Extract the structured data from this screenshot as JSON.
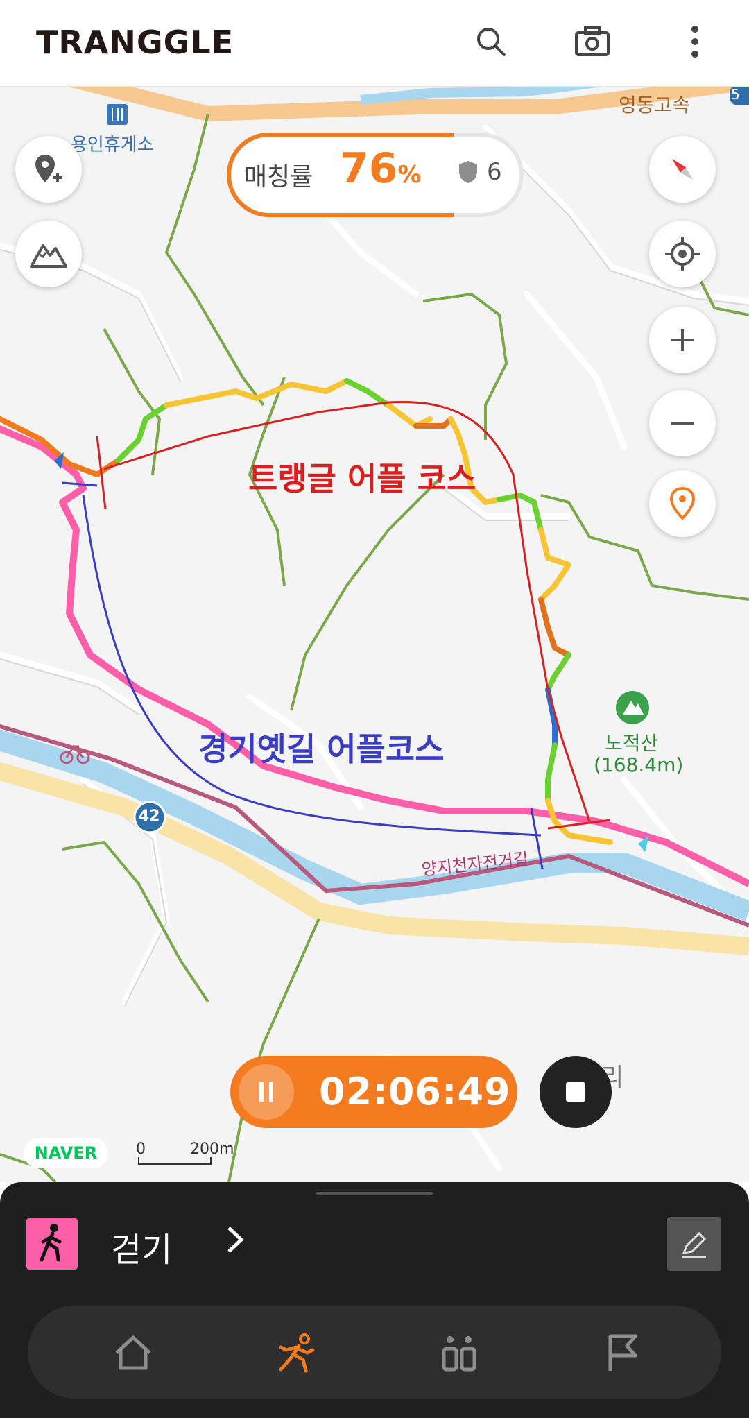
{
  "header": {
    "logo": "TRANGGLE"
  },
  "icons": {
    "search": "search-icon",
    "camera": "camera-icon",
    "more": "more-vert-icon",
    "add_place": "add-location-icon",
    "mountain": "mountain-icon",
    "compass": "compass-icon",
    "my_location": "gps-target-icon",
    "zoom_in": "plus-icon",
    "zoom_out": "minus-icon",
    "pin": "map-pin-icon"
  },
  "match": {
    "label": "매칭률",
    "value": "76",
    "unit": "%",
    "count": "6",
    "progress": 0.76
  },
  "map": {
    "labels": {
      "rest_area": "용인휴게소",
      "highway": "영동고속",
      "mountain_name": "노적산",
      "mountain_height": "(168.4m)",
      "bike_road": "양지천자전거길",
      "village": "송문리",
      "route_42": "42",
      "route_5": "5"
    },
    "annotations": {
      "trangle_course": "트랭글 어플 코스",
      "gyeonggi_course": "경기옛길 어플코스"
    },
    "attribution": "NAVER",
    "scale": {
      "zero": "0",
      "distance": "200m"
    }
  },
  "timer": {
    "elapsed": "02:06:49"
  },
  "activity": {
    "label": "걷기"
  },
  "nav": {
    "items": [
      "home",
      "activity",
      "community",
      "challenge"
    ],
    "active": "activity"
  },
  "colors": {
    "accent": "#f47b20",
    "activity_icon": "#ff5fa8",
    "panel": "#1f1f1f",
    "annot_red": "#d92020",
    "annot_blue": "#3a3dbf"
  }
}
